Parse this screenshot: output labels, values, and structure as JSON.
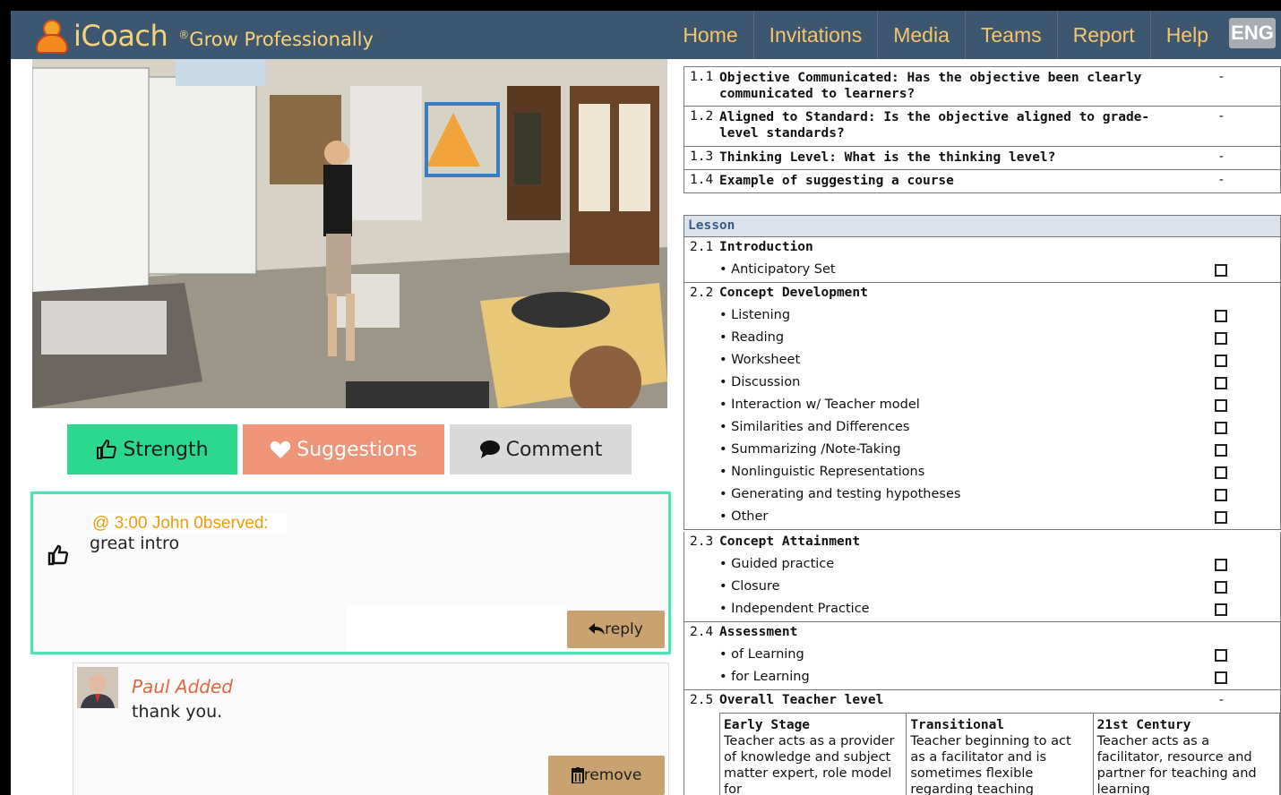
{
  "header": {
    "app_name": "iCoach",
    "tagline": "Grow Professionally",
    "tagline_mark": "®",
    "nav": [
      "Home",
      "Invitations",
      "Media",
      "Teams",
      "Report",
      "Help"
    ],
    "lang": "ENG"
  },
  "buttons": {
    "strength": "Strength",
    "suggestions": "Suggestions",
    "comment": "Comment"
  },
  "comment": {
    "stamp": "@ 3:00 John 0bserved:",
    "text": "great intro",
    "reply_label": "reply"
  },
  "reply": {
    "author": "Paul Added",
    "text": "thank you.",
    "remove_label": "remove"
  },
  "objective": [
    {
      "num": "1.1",
      "q": "Objective Communicated: Has the objective been clearly communicated to learners?",
      "val": "-"
    },
    {
      "num": "1.2",
      "q": "Aligned to Standard: Is the objective aligned to grade-level standards?",
      "val": "-"
    },
    {
      "num": "1.3",
      "q": "Thinking Level: What is the thinking level?",
      "val": "-"
    },
    {
      "num": "1.4",
      "q": "Example of suggesting a course",
      "val": "-"
    }
  ],
  "lesson": {
    "title": "Lesson",
    "sections": [
      {
        "num": "2.1",
        "title": "Introduction",
        "items": [
          "• Anticipatory Set"
        ]
      },
      {
        "num": "2.2",
        "title": "Concept Development",
        "items": [
          "• Listening",
          "• Reading",
          "• Worksheet",
          "• Discussion",
          "• Interaction w/ Teacher model",
          "• Similarities and Differences",
          "• Summarizing /Note-Taking",
          "• Nonlinguistic Representations",
          "• Generating and testing hypotheses",
          "• Other"
        ]
      },
      {
        "num": "2.3",
        "title": "Concept Attainment",
        "items": [
          "• Guided practice",
          "• Closure",
          "• Independent Practice"
        ]
      },
      {
        "num": "2.4",
        "title": "Assessment",
        "items": [
          "• of Learning",
          "• for Learning"
        ]
      }
    ],
    "overall": {
      "num": "2.5",
      "title": "Overall Teacher level",
      "val": "-",
      "levels": [
        {
          "name": "Early Stage",
          "desc": "Teacher acts as a provider of knowledge and subject matter expert, role model for"
        },
        {
          "name": "Transitional",
          "desc": "Teacher beginning to act as a facilitator and is sometimes flexible regarding teaching"
        },
        {
          "name": "21st Century",
          "desc": "Teacher acts as a facilitator, resource and partner for teaching and learning"
        }
      ]
    }
  }
}
